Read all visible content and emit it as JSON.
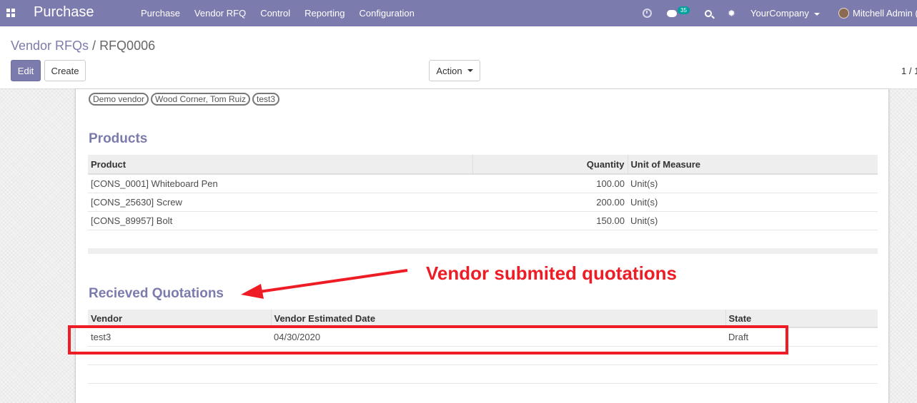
{
  "navbar": {
    "brand": "Purchase",
    "menu": [
      "Purchase",
      "Vendor RFQ",
      "Control",
      "Reporting",
      "Configuration"
    ],
    "message_count": "35",
    "company": "YourCompany",
    "user": "Mitchell Admin ("
  },
  "breadcrumb": {
    "parent": "Vendor RFQs",
    "separator": "/",
    "current": "RFQ0006"
  },
  "buttons": {
    "edit": "Edit",
    "create": "Create",
    "action": "Action"
  },
  "pager": "1 / 1",
  "vendor_tags": [
    "Demo vendor",
    "Wood Corner, Tom Ruiz",
    "test3"
  ],
  "products": {
    "title": "Products",
    "columns": [
      "Product",
      "Quantity",
      "Unit of Measure"
    ],
    "rows": [
      [
        "[CONS_0001] Whiteboard Pen",
        "100.00",
        "Unit(s)"
      ],
      [
        "[CONS_25630] Screw",
        "200.00",
        "Unit(s)"
      ],
      [
        "[CONS_89957] Bolt",
        "150.00",
        "Unit(s)"
      ]
    ]
  },
  "quotations": {
    "title": "Recieved Quotations",
    "columns": [
      "Vendor",
      "Vendor Estimated Date",
      "State"
    ],
    "rows": [
      [
        "test3",
        "04/30/2020",
        "Draft"
      ]
    ]
  },
  "annotation": {
    "text": "Vendor submited quotations",
    "color": "#ee1c25"
  },
  "colors": {
    "navbar": "#7c7bad",
    "accent": "#7c7bad"
  },
  "icons": [
    "apps-icon",
    "clock-icon",
    "chat-icon",
    "search-icon",
    "bug-icon",
    "caret-down-icon"
  ]
}
